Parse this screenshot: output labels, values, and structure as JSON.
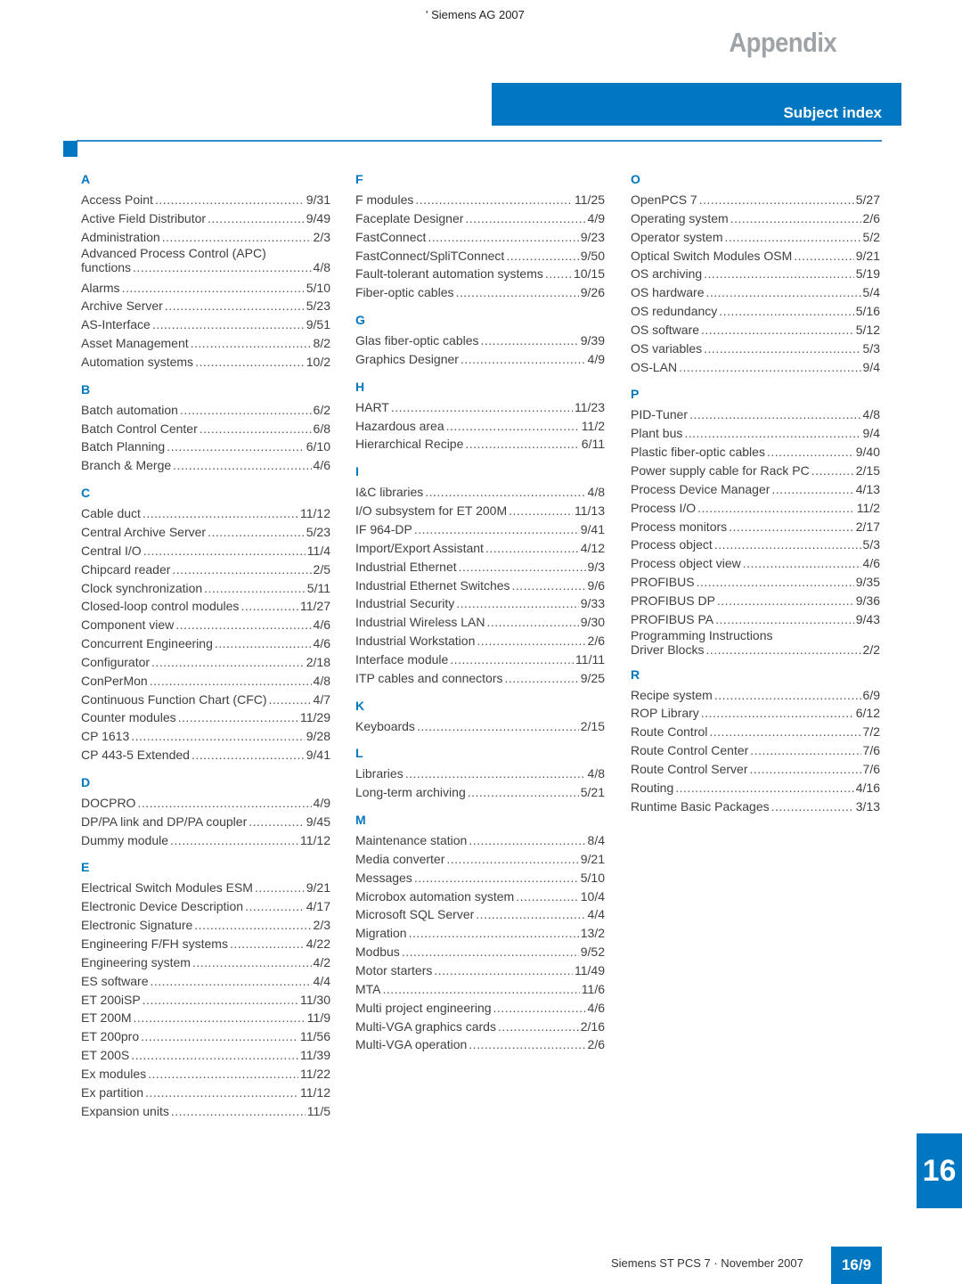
{
  "header": {
    "copyright": "' Siemens AG 2007",
    "chapter": "Appendix",
    "section_title": "Subject index"
  },
  "colors": {
    "accent_blue": "#0077c0",
    "heading_gray": "#9ea3a7"
  },
  "columns": [
    {
      "sections": [
        {
          "letter": "A",
          "entries": [
            {
              "name": "Access Point",
              "page": "9/31"
            },
            {
              "name": "Active Field Distributor",
              "page": "9/49"
            },
            {
              "name": "Administration",
              "page": "2/3"
            },
            {
              "name": "Advanced Process Control (APC)",
              "name2": "functions",
              "page": "4/8"
            },
            {
              "name": "Alarms",
              "page": "5/10"
            },
            {
              "name": "Archive Server",
              "page": "5/23"
            },
            {
              "name": "AS-Interface",
              "page": "9/51"
            },
            {
              "name": "Asset Management",
              "page": "8/2"
            },
            {
              "name": "Automation systems",
              "page": "10/2"
            }
          ]
        },
        {
          "letter": "B",
          "entries": [
            {
              "name": "Batch automation",
              "page": "6/2"
            },
            {
              "name": "Batch Control Center",
              "page": "6/8"
            },
            {
              "name": "Batch Planning",
              "page": "6/10"
            },
            {
              "name": "Branch & Merge",
              "page": "4/6"
            }
          ]
        },
        {
          "letter": "C",
          "entries": [
            {
              "name": "Cable duct",
              "page": "11/12"
            },
            {
              "name": "Central Archive Server",
              "page": "5/23"
            },
            {
              "name": "Central I/O",
              "page": "11/4"
            },
            {
              "name": "Chipcard reader",
              "page": "2/5"
            },
            {
              "name": "Clock synchronization",
              "page": "5/11"
            },
            {
              "name": "Closed-loop control modules",
              "page": "11/27"
            },
            {
              "name": "Component view",
              "page": "4/6"
            },
            {
              "name": "Concurrent Engineering",
              "page": "4/6"
            },
            {
              "name": "Configurator",
              "page": "2/18"
            },
            {
              "name": "ConPerMon",
              "page": "4/8"
            },
            {
              "name": "Continuous Function Chart (CFC)",
              "page": "4/7"
            },
            {
              "name": "Counter modules",
              "page": "11/29"
            },
            {
              "name": "CP 1613",
              "page": "9/28"
            },
            {
              "name": "CP 443-5 Extended",
              "page": "9/41"
            }
          ]
        },
        {
          "letter": "D",
          "entries": [
            {
              "name": "DOCPRO",
              "page": "4/9"
            },
            {
              "name": "DP/PA link and DP/PA coupler",
              "page": "9/45"
            },
            {
              "name": "Dummy module",
              "page": "11/12"
            }
          ]
        },
        {
          "letter": "E",
          "entries": [
            {
              "name": "Electrical Switch Modules ESM",
              "page": "9/21"
            },
            {
              "name": "Electronic Device Description",
              "page": "4/17"
            },
            {
              "name": "Electronic Signature",
              "page": "2/3"
            },
            {
              "name": "Engineering F/FH systems",
              "page": "4/22"
            },
            {
              "name": "Engineering system",
              "page": "4/2"
            },
            {
              "name": "ES software",
              "page": "4/4"
            },
            {
              "name": "ET 200iSP",
              "page": "11/30"
            },
            {
              "name": "ET 200M",
              "page": "11/9"
            },
            {
              "name": "ET 200pro",
              "page": "11/56"
            },
            {
              "name": "ET 200S",
              "page": "11/39"
            },
            {
              "name": "Ex modules",
              "page": "11/22"
            },
            {
              "name": "Ex partition",
              "page": "11/12"
            },
            {
              "name": "Expansion units",
              "page": "11/5"
            }
          ]
        }
      ]
    },
    {
      "sections": [
        {
          "letter": "F",
          "entries": [
            {
              "name": "F modules",
              "page": "11/25"
            },
            {
              "name": "Faceplate Designer",
              "page": "4/9"
            },
            {
              "name": "FastConnect",
              "page": "9/23"
            },
            {
              "name": "FastConnect/SpliTConnect",
              "page": "9/50"
            },
            {
              "name": "Fault-tolerant automation systems",
              "page": "10/15"
            },
            {
              "name": "Fiber-optic cables",
              "page": "9/26"
            }
          ]
        },
        {
          "letter": "G",
          "entries": [
            {
              "name": "Glas fiber-optic cables",
              "page": "9/39"
            },
            {
              "name": "Graphics Designer",
              "page": "4/9"
            }
          ]
        },
        {
          "letter": "H",
          "entries": [
            {
              "name": "HART",
              "page": "11/23"
            },
            {
              "name": "Hazardous area",
              "page": "11/2"
            },
            {
              "name": "Hierarchical Recipe",
              "page": "6/11"
            }
          ]
        },
        {
          "letter": "I",
          "entries": [
            {
              "name": "I&C libraries",
              "page": "4/8"
            },
            {
              "name": "I/O subsystem for ET 200M",
              "page": "11/13"
            },
            {
              "name": "IF 964-DP",
              "page": "9/41"
            },
            {
              "name": "Import/Export Assistant",
              "page": "4/12"
            },
            {
              "name": "Industrial Ethernet",
              "page": "9/3"
            },
            {
              "name": "Industrial Ethernet Switches",
              "page": "9/6"
            },
            {
              "name": "Industrial Security",
              "page": "9/33"
            },
            {
              "name": "Industrial Wireless LAN",
              "page": "9/30"
            },
            {
              "name": "Industrial Workstation",
              "page": "2/6"
            },
            {
              "name": "Interface module",
              "page": "11/11"
            },
            {
              "name": "ITP cables and connectors",
              "page": "9/25"
            }
          ]
        },
        {
          "letter": "K",
          "entries": [
            {
              "name": "Keyboards",
              "page": "2/15"
            }
          ]
        },
        {
          "letter": "L",
          "entries": [
            {
              "name": "Libraries",
              "page": "4/8"
            },
            {
              "name": "Long-term archiving",
              "page": "5/21"
            }
          ]
        },
        {
          "letter": "M",
          "entries": [
            {
              "name": "Maintenance station",
              "page": "8/4"
            },
            {
              "name": "Media converter",
              "page": "9/21"
            },
            {
              "name": "Messages",
              "page": "5/10"
            },
            {
              "name": "Microbox automation system",
              "page": "10/4"
            },
            {
              "name": "Microsoft SQL Server",
              "page": "4/4"
            },
            {
              "name": "Migration",
              "page": "13/2"
            },
            {
              "name": "Modbus",
              "page": "9/52"
            },
            {
              "name": "Motor starters",
              "page": "11/49"
            },
            {
              "name": "MTA",
              "page": "11/6"
            },
            {
              "name": "Multi project engineering",
              "page": "4/6"
            },
            {
              "name": "Multi-VGA graphics cards",
              "page": "2/16"
            },
            {
              "name": "Multi-VGA operation",
              "page": "2/6"
            }
          ]
        }
      ]
    },
    {
      "sections": [
        {
          "letter": "O",
          "entries": [
            {
              "name": "OpenPCS 7",
              "page": "5/27"
            },
            {
              "name": "Operating system",
              "page": "2/6"
            },
            {
              "name": "Operator system",
              "page": "5/2"
            },
            {
              "name": "Optical Switch Modules OSM",
              "page": "9/21"
            },
            {
              "name": "OS archiving",
              "page": "5/19"
            },
            {
              "name": "OS hardware",
              "page": "5/4"
            },
            {
              "name": "OS redundancy",
              "page": "5/16"
            },
            {
              "name": "OS software",
              "page": "5/12"
            },
            {
              "name": "OS variables",
              "page": "5/3"
            },
            {
              "name": "OS-LAN",
              "page": "9/4"
            }
          ]
        },
        {
          "letter": "P",
          "entries": [
            {
              "name": "PID-Tuner",
              "page": "4/8"
            },
            {
              "name": "Plant bus",
              "page": "9/4"
            },
            {
              "name": "Plastic fiber-optic cables",
              "page": "9/40"
            },
            {
              "name": "Power supply cable for Rack PC",
              "page": "2/15"
            },
            {
              "name": "Process Device Manager",
              "page": "4/13"
            },
            {
              "name": "Process I/O",
              "page": "11/2"
            },
            {
              "name": "Process monitors",
              "page": "2/17"
            },
            {
              "name": "Process object",
              "page": "5/3"
            },
            {
              "name": "Process object view",
              "page": "4/6"
            },
            {
              "name": "PROFIBUS",
              "page": "9/35"
            },
            {
              "name": "PROFIBUS DP",
              "page": "9/36"
            },
            {
              "name": "PROFIBUS PA",
              "page": "9/43"
            },
            {
              "name": "Programming Instructions",
              "name2": "Driver Blocks",
              "page": "2/2"
            }
          ]
        },
        {
          "letter": "R",
          "entries": [
            {
              "name": "Recipe system",
              "page": "6/9"
            },
            {
              "name": "ROP Library",
              "page": "6/12"
            },
            {
              "name": "Route Control",
              "page": "7/2"
            },
            {
              "name": "Route Control Center",
              "page": "7/6"
            },
            {
              "name": "Route Control Server",
              "page": "7/6"
            },
            {
              "name": "Routing",
              "page": "4/16"
            },
            {
              "name": "Runtime Basic Packages",
              "page": "3/13"
            }
          ]
        }
      ]
    }
  ],
  "footer": {
    "chapter_tab": "16",
    "publication": "Siemens ST PCS 7 · November 2007",
    "page_number": "16/9"
  }
}
